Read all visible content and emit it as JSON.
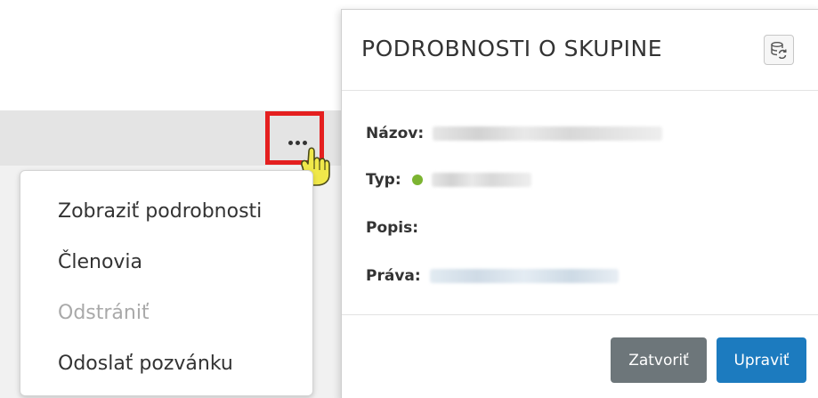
{
  "list_row": {
    "more_button_label": "•••"
  },
  "context_menu": {
    "items": [
      {
        "label": "Zobraziť podrobnosti",
        "enabled": true
      },
      {
        "label": "Členovia",
        "enabled": true
      },
      {
        "label": "Odstrániť",
        "enabled": false
      },
      {
        "label": "Odoslať pozvánku",
        "enabled": true
      }
    ]
  },
  "modal": {
    "title": "PODROBNOSTI O SKUPINE",
    "refresh_icon": "database-refresh-icon",
    "fields": {
      "name_label": "Názov:",
      "type_label": "Typ:",
      "description_label": "Popis:",
      "rights_label": "Práva:"
    },
    "type_status_color": "#7cb431",
    "buttons": {
      "close_label": "Zatvoriť",
      "edit_label": "Upraviť"
    }
  },
  "colors": {
    "highlight_border": "#e41f1f",
    "primary_button": "#1c7bbf",
    "secondary_button": "#6d767a",
    "cursor": "#f0e84a"
  }
}
